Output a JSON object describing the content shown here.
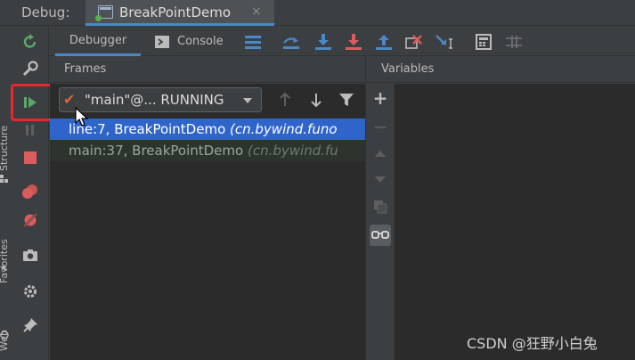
{
  "titlebar": {
    "debug_label": "Debug:",
    "tab_title": "BreakPointDemo",
    "tab_close": "×"
  },
  "side_strip": {
    "structure_label": "Structure",
    "favorites_label": "Favorites",
    "web_label": "Web"
  },
  "debug_actions": [
    {
      "name": "rerun",
      "icon": "rerun-icon"
    },
    {
      "name": "modify-config",
      "icon": "wrench-icon"
    },
    {
      "name": "resume",
      "icon": "resume-icon"
    },
    {
      "name": "pause",
      "icon": "pause-icon"
    },
    {
      "name": "stop",
      "icon": "stop-icon"
    },
    {
      "name": "view-breakpoints",
      "icon": "breakpoints-icon"
    },
    {
      "name": "mute-breakpoints",
      "icon": "mute-breakpoints-icon"
    },
    {
      "name": "snapshot",
      "icon": "camera-icon"
    },
    {
      "name": "settings",
      "icon": "gear-icon"
    },
    {
      "name": "pin",
      "icon": "pin-icon"
    }
  ],
  "subtabs": {
    "debugger_label": "Debugger",
    "console_label": "Console"
  },
  "frames": {
    "header": "Frames",
    "thread_selected": "\"main\"@... RUNNING",
    "rows": [
      {
        "location": "line:7, BreakPointDemo",
        "package": "(cn.bywind.funo"
      },
      {
        "location": "main:37, BreakPointDemo",
        "package": "(cn.bywind.fu"
      }
    ]
  },
  "variables": {
    "header": "Variables"
  },
  "watermark": "CSDN @狂野小白兔",
  "colors": {
    "accent_blue": "#4a88c7",
    "selection_blue": "#2f65ca",
    "resume_green": "#59a869",
    "stop_red": "#db5c5c",
    "highlight_red": "#e8282b"
  }
}
